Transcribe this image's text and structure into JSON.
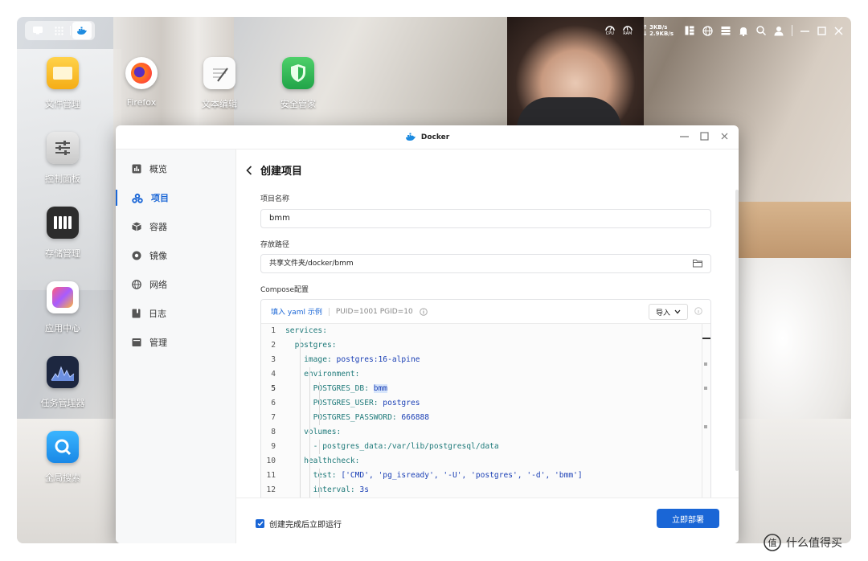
{
  "desktop": {
    "icons": [
      {
        "label": "文件管理"
      },
      {
        "label": "Firefox"
      },
      {
        "label": "文本编辑"
      },
      {
        "label": "安全管家"
      },
      {
        "label": "控制面板"
      },
      {
        "label": "存储管理"
      },
      {
        "label": "应用中心"
      },
      {
        "label": "任务管理器"
      },
      {
        "label": "全局搜索"
      }
    ]
  },
  "topbar": {
    "cpu_label": "CPU",
    "ram_label": "RAM",
    "net_up": "↑ 3KB/s",
    "net_down": "↓ 2.9KB/s"
  },
  "window": {
    "title": "Docker",
    "sidebar": [
      {
        "label": "概览",
        "icon": "chart-icon"
      },
      {
        "label": "项目",
        "icon": "project-icon"
      },
      {
        "label": "容器",
        "icon": "container-icon"
      },
      {
        "label": "镜像",
        "icon": "image-icon"
      },
      {
        "label": "网络",
        "icon": "network-icon"
      },
      {
        "label": "日志",
        "icon": "log-icon"
      },
      {
        "label": "管理",
        "icon": "manage-icon"
      }
    ],
    "page_title": "创建项目",
    "name_label": "项目名称",
    "name_value": "bmm",
    "path_label": "存放路径",
    "path_value": "共享文件夹/docker/bmm",
    "compose_label": "Compose配置",
    "compose_link": "填入 yaml 示例",
    "compose_env": "PUID=1001 PGID=10",
    "import_label": "导入",
    "code_lines": [
      {
        "n": "1",
        "a": "",
        "k": "services:",
        "v": ""
      },
      {
        "n": "2",
        "a": "  ",
        "k": "postgres:",
        "v": ""
      },
      {
        "n": "3",
        "a": "    ",
        "k": "image:",
        "v": " postgres:16-alpine"
      },
      {
        "n": "4",
        "a": "    ",
        "k": "environment:",
        "v": ""
      },
      {
        "n": "5",
        "a": "      ",
        "k": "POSTGRES_DB:",
        "v": " bmm"
      },
      {
        "n": "6",
        "a": "      ",
        "k": "POSTGRES_USER:",
        "v": " postgres"
      },
      {
        "n": "7",
        "a": "      ",
        "k": "POSTGRES_PASSWORD:",
        "v": " 666888"
      },
      {
        "n": "8",
        "a": "    ",
        "k": "volumes:",
        "v": ""
      },
      {
        "n": "9",
        "a": "      ",
        "k": "- postgres_data:/var/lib/postgresql/data",
        "v": ""
      },
      {
        "n": "10",
        "a": "    ",
        "k": "healthcheck:",
        "v": ""
      },
      {
        "n": "11",
        "a": "      ",
        "k": "test:",
        "v": " ['CMD', 'pg_isready', '-U', 'postgres', '-d', 'bmm']"
      },
      {
        "n": "12",
        "a": "      ",
        "k": "interval:",
        "v": " 3s"
      }
    ],
    "autorun_label": "创建完成后立即运行",
    "deploy_label": "立即部署"
  },
  "watermark": "什么值得买",
  "colors": {
    "accent": "#1a66d6",
    "code_key": "#1f7a7a",
    "code_value": "#1a3fb5"
  }
}
